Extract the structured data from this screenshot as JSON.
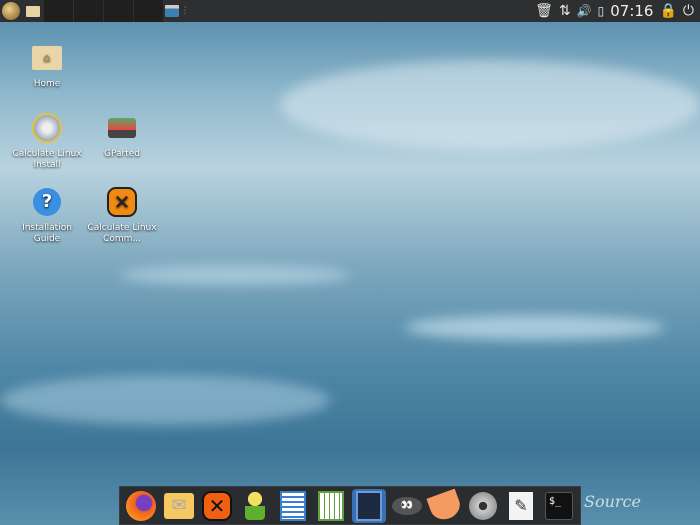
{
  "panel": {
    "clock": "07:16",
    "menu_icon": "calculate-menu-icon",
    "tasks": 4
  },
  "desktop": {
    "icons": [
      {
        "label": "Home",
        "icon": "home-folder-icon"
      },
      {
        "label": "Calculate Linux Install",
        "icon": "installer-disc-icon"
      },
      {
        "label": "GParted",
        "icon": "gparted-icon"
      },
      {
        "label": "Installation Guide",
        "icon": "help-icon"
      },
      {
        "label": "Calculate Linux Comm...",
        "icon": "calculate-console-icon"
      }
    ]
  },
  "dock": {
    "items": [
      "firefox",
      "mail",
      "calculate-console",
      "contacts",
      "writer",
      "calc",
      "calculator",
      "gimp",
      "clementine",
      "video-player",
      "text-editor",
      "terminal"
    ]
  },
  "wallpaper": {
    "text": "Source"
  },
  "colors": {
    "panel": "#2e2f30",
    "dock": "#2a2d30"
  }
}
